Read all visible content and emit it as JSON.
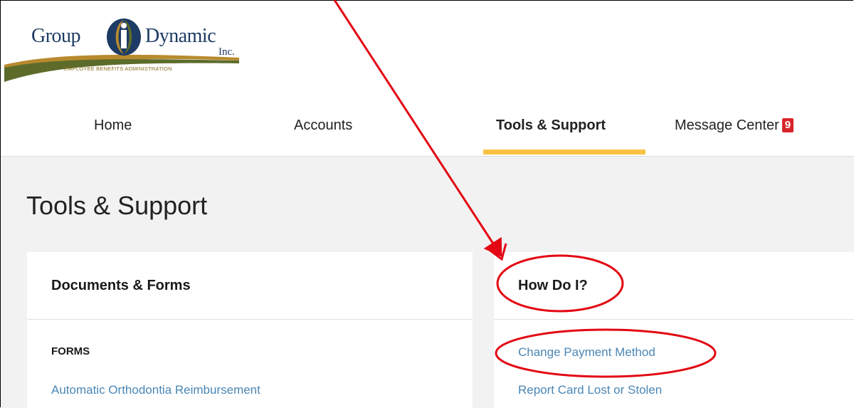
{
  "brand": {
    "word1": "Group",
    "word2": "Dynamic",
    "suffix": "Inc.",
    "tagline": "EMPLOYEE BENEFITS ADMINISTRATION",
    "colors": {
      "navy": "#1d3b64",
      "green": "#5c6b2a",
      "gold": "#b88a2e"
    }
  },
  "nav": {
    "items": [
      {
        "label": "Home"
      },
      {
        "label": "Accounts"
      },
      {
        "label": "Tools & Support"
      },
      {
        "label": "Message Center"
      }
    ],
    "active_index": 2,
    "message_badge": "9"
  },
  "page": {
    "title": "Tools & Support"
  },
  "cards": {
    "documents": {
      "title": "Documents & Forms",
      "section_label": "FORMS",
      "links": [
        "Automatic Orthodontia Reimbursement"
      ]
    },
    "howdoi": {
      "title": "How Do I?",
      "links": [
        "Change Payment Method",
        "Report Card Lost or Stolen"
      ]
    }
  },
  "annotation": {
    "color": "#e30613"
  },
  "colors": {
    "accent": "#f7c244",
    "link": "#4a86b5",
    "badge": "#d7262b",
    "background": "#f2f2f2"
  }
}
